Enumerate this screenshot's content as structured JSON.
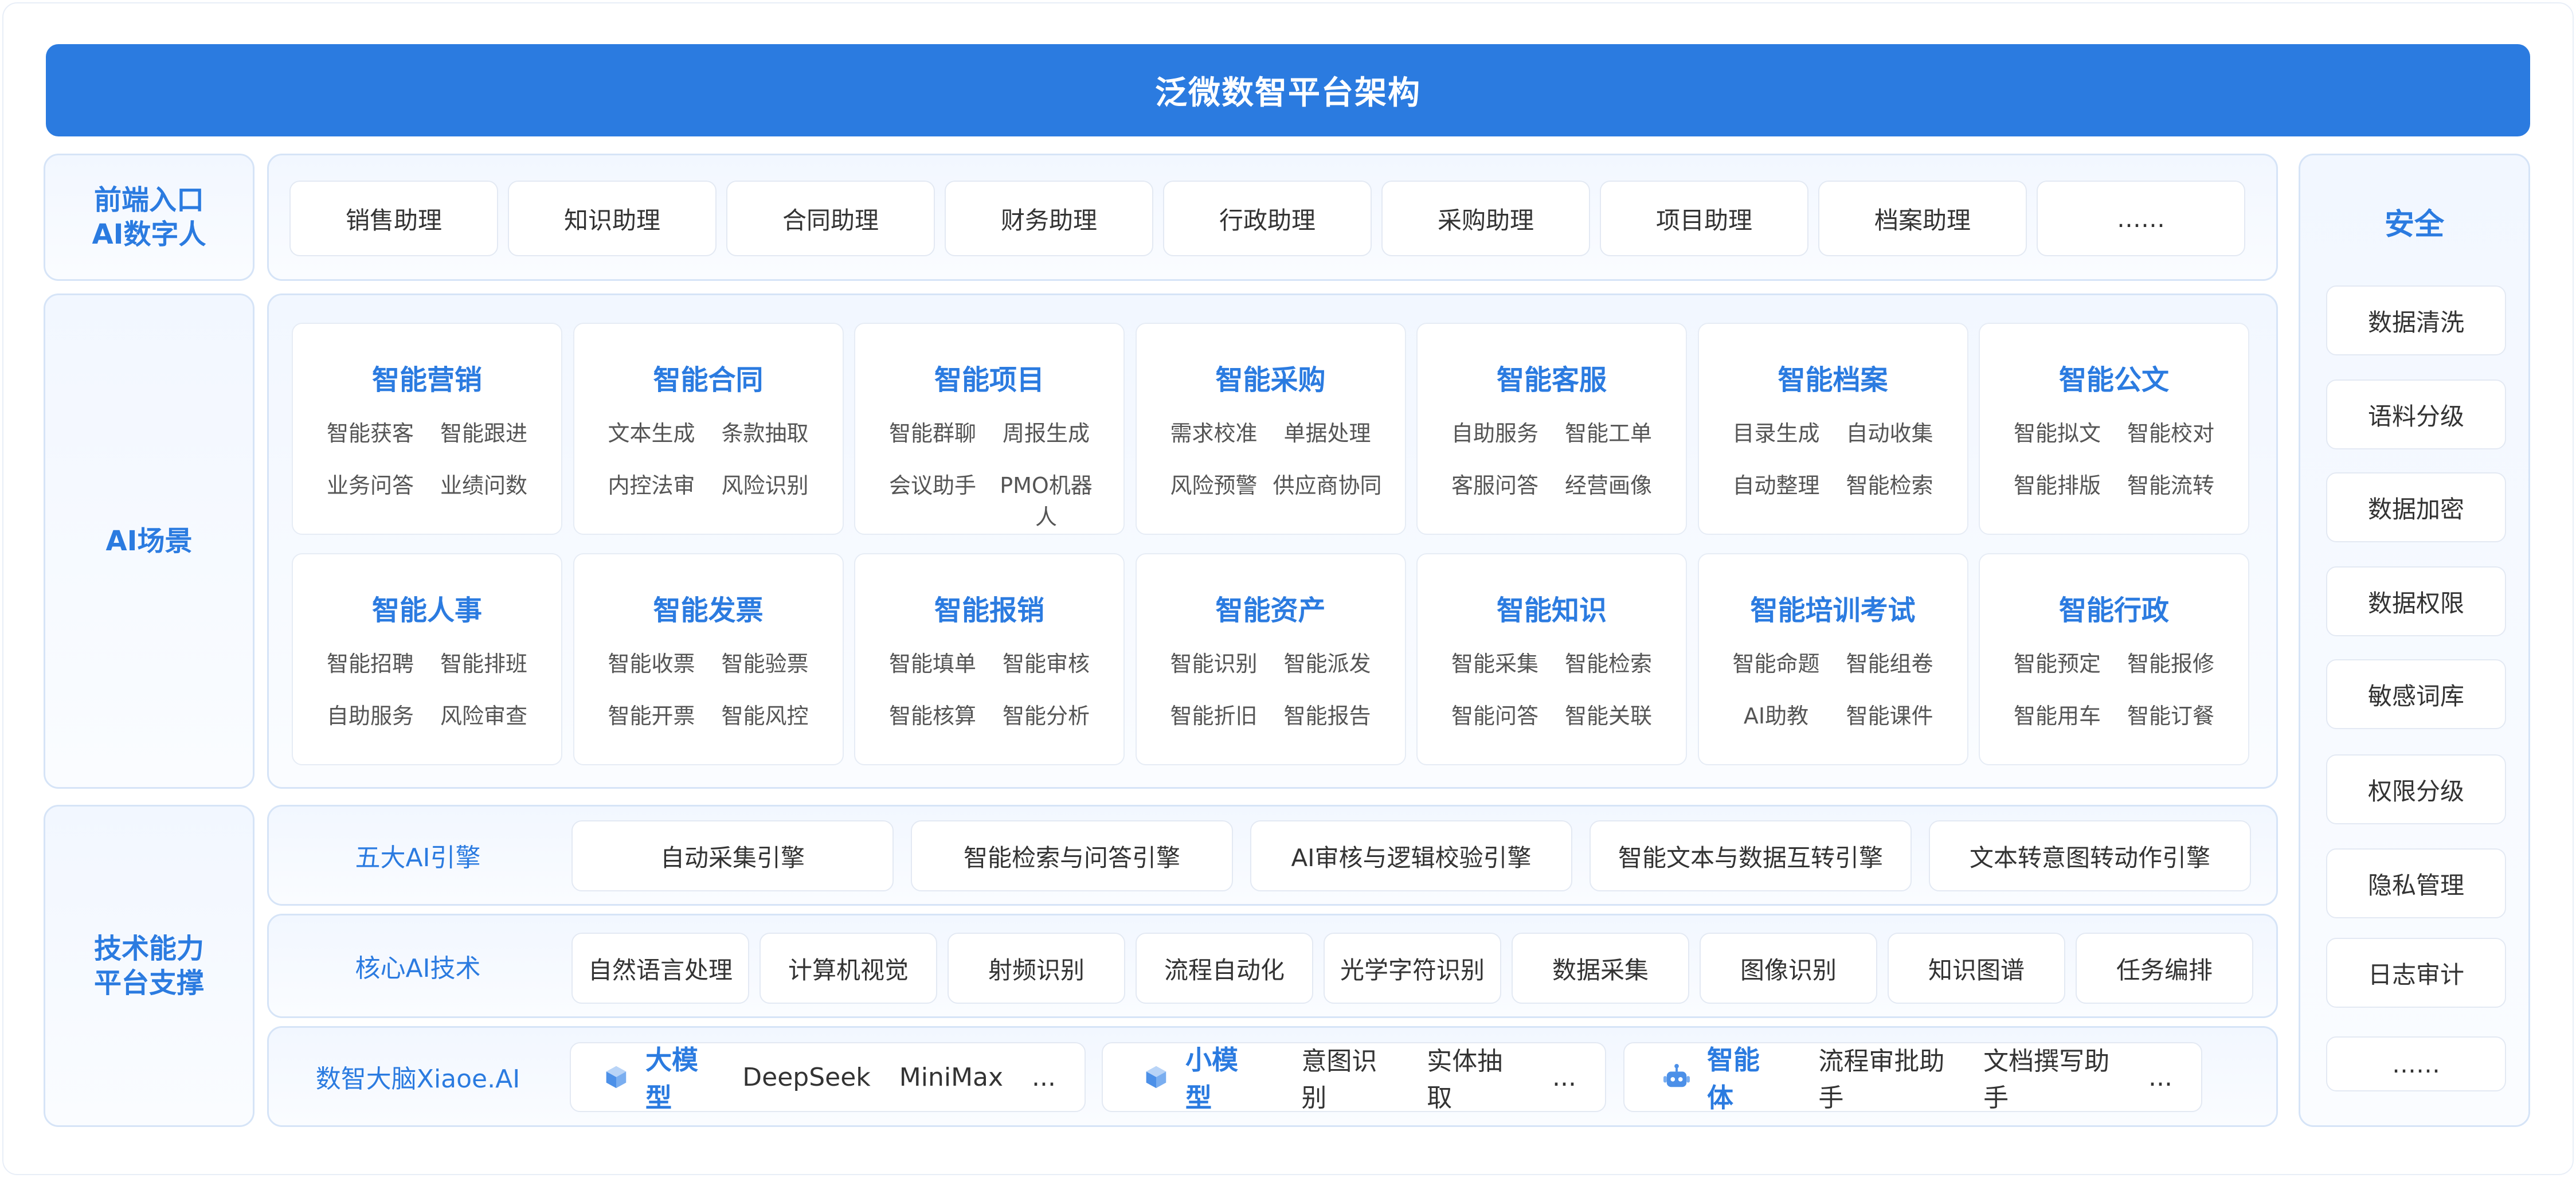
{
  "title": "泛微数智平台架构",
  "colors": {
    "accent": "#2b7be0",
    "panel_border": "#d6e4f7",
    "panel_bg": "#f2f7ff"
  },
  "frontend": {
    "label_line1": "前端入口",
    "label_line2": "AI数字人",
    "assistants": [
      "销售助理",
      "知识助理",
      "合同助理",
      "财务助理",
      "行政助理",
      "采购助理",
      "项目助理",
      "档案助理",
      "……"
    ]
  },
  "ai_scene": {
    "label": "AI场景",
    "cards": [
      {
        "title": "智能营销",
        "items": [
          "智能获客",
          "智能跟进",
          "业务问答",
          "业绩问数"
        ]
      },
      {
        "title": "智能合同",
        "items": [
          "文本生成",
          "条款抽取",
          "内控法审",
          "风险识别"
        ]
      },
      {
        "title": "智能项目",
        "items": [
          "智能群聊",
          "周报生成",
          "会议助手",
          "PMO机器人"
        ]
      },
      {
        "title": "智能采购",
        "items": [
          "需求校准",
          "单据处理",
          "风险预警",
          "供应商协同"
        ]
      },
      {
        "title": "智能客服",
        "items": [
          "自助服务",
          "智能工单",
          "客服问答",
          "经营画像"
        ]
      },
      {
        "title": "智能档案",
        "items": [
          "目录生成",
          "自动收集",
          "自动整理",
          "智能检索"
        ]
      },
      {
        "title": "智能公文",
        "items": [
          "智能拟文",
          "智能校对",
          "智能排版",
          "智能流转"
        ]
      },
      {
        "title": "智能人事",
        "items": [
          "智能招聘",
          "智能排班",
          "自助服务",
          "风险审查"
        ]
      },
      {
        "title": "智能发票",
        "items": [
          "智能收票",
          "智能验票",
          "智能开票",
          "智能风控"
        ]
      },
      {
        "title": "智能报销",
        "items": [
          "智能填单",
          "智能审核",
          "智能核算",
          "智能分析"
        ]
      },
      {
        "title": "智能资产",
        "items": [
          "智能识别",
          "智能派发",
          "智能折旧",
          "智能报告"
        ]
      },
      {
        "title": "智能知识",
        "items": [
          "智能采集",
          "智能检索",
          "智能问答",
          "智能关联"
        ]
      },
      {
        "title": "智能培训考试",
        "items": [
          "智能命题",
          "智能组卷",
          "AI助教",
          "智能课件"
        ]
      },
      {
        "title": "智能行政",
        "items": [
          "智能预定",
          "智能报修",
          "智能用车",
          "智能订餐"
        ]
      }
    ]
  },
  "tech": {
    "label_line1": "技术能力",
    "label_line2": "平台支撑",
    "engines": {
      "label": "五大AI引擎",
      "items": [
        "自动采集引擎",
        "智能检索与问答引擎",
        "AI审核与逻辑校验引擎",
        "智能文本与数据互转引擎",
        "文本转意图转动作引擎"
      ]
    },
    "core": {
      "label": "核心AI技术",
      "items": [
        "自然语言处理",
        "计算机视觉",
        "射频识别",
        "流程自动化",
        "光学字符识别",
        "数据采集",
        "图像识别",
        "知识图谱",
        "任务编排"
      ]
    },
    "brain": {
      "label": "数智大脑Xiaoe.AI",
      "models": [
        {
          "icon": "cube-icon",
          "name": "大模型",
          "items": [
            "DeepSeek",
            "MiniMax",
            "..."
          ]
        },
        {
          "icon": "cube-icon",
          "name": "小模型",
          "items": [
            "意图识别",
            "实体抽取",
            "..."
          ]
        },
        {
          "icon": "robot-icon",
          "name": "智能体",
          "items": [
            "流程审批助手",
            "文档撰写助手",
            "..."
          ]
        }
      ]
    }
  },
  "security": {
    "label": "安全",
    "items": [
      "数据清洗",
      "语料分级",
      "数据加密",
      "数据权限",
      "敏感词库",
      "权限分级",
      "隐私管理",
      "日志审计",
      "……"
    ]
  }
}
